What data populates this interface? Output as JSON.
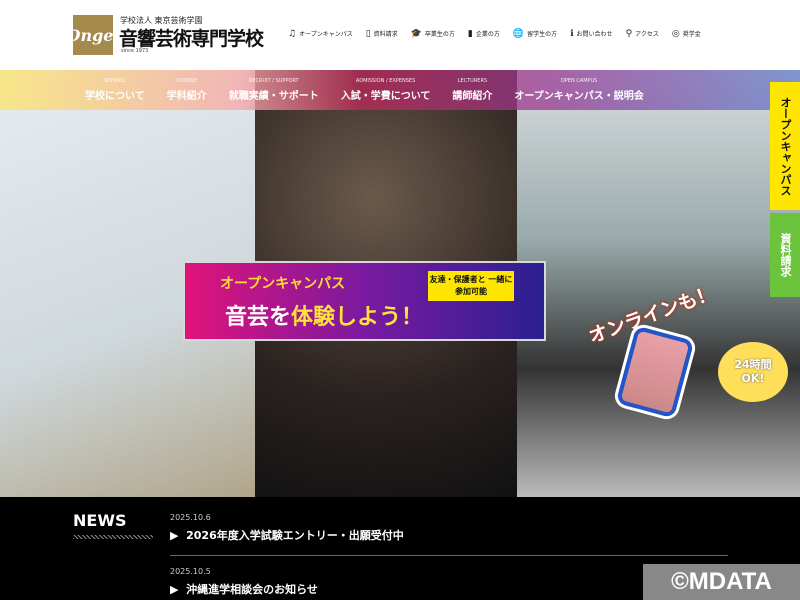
{
  "header": {
    "logo_text": "Ongei",
    "corp": "学校法人 東京芸術学園",
    "school": "音響芸術専門学校",
    "since": "since 1973",
    "utility": [
      {
        "icon": "music-icon",
        "g": "♫",
        "label": "オープンキャンパス"
      },
      {
        "icon": "document-icon",
        "g": "▯",
        "label": "資料請求"
      },
      {
        "icon": "graduation-cap-icon",
        "g": "🎓",
        "label": "卒業生の方"
      },
      {
        "icon": "building-icon",
        "g": "▮",
        "label": "企業の方"
      },
      {
        "icon": "globe-icon",
        "g": "🌐",
        "label": "留学生の方"
      },
      {
        "icon": "info-icon",
        "g": "ℹ",
        "label": "お問い合わせ"
      },
      {
        "icon": "map-pin-icon",
        "g": "⚲",
        "label": "アクセス"
      },
      {
        "icon": "scholarship-icon",
        "g": "◎",
        "label": "奨学金"
      }
    ]
  },
  "nav": [
    {
      "en": "SCHOOL",
      "ja": "学校について"
    },
    {
      "en": "COURSE",
      "ja": "学科紹介"
    },
    {
      "en": "RECRUIT / SUPPORT",
      "ja": "就職実績・サポート"
    },
    {
      "en": "ADMISSION / EXPENSES",
      "ja": "入試・学費について"
    },
    {
      "en": "LECTURERS",
      "ja": "講師紹介"
    },
    {
      "en": "OPEN CAMPUS",
      "ja": "オープンキャンパス・説明会"
    }
  ],
  "side": {
    "open_campus": "オープンキャンパス",
    "request": "資料請求"
  },
  "banner": {
    "open_campus": "オープンキャンパス",
    "headline_a": "音芸を",
    "headline_b": "体験しよう！",
    "friends": "友達・保護者と 一緒に参加可能",
    "online": "オンラインも！",
    "h24_a": "24時間",
    "h24_b": "OK!"
  },
  "news": {
    "title": "NEWS",
    "items": [
      {
        "date": "2025.10.6",
        "title": "2026年度入学試験エントリー・出願受付中"
      },
      {
        "date": "2025.10.5",
        "title": "沖縄進学相談会のお知らせ"
      }
    ]
  },
  "watermark": "©MDATA",
  "colors": {
    "yellow_tab": "#ffe600",
    "green_tab": "#6cc43c",
    "logo": "#a58a4e"
  }
}
